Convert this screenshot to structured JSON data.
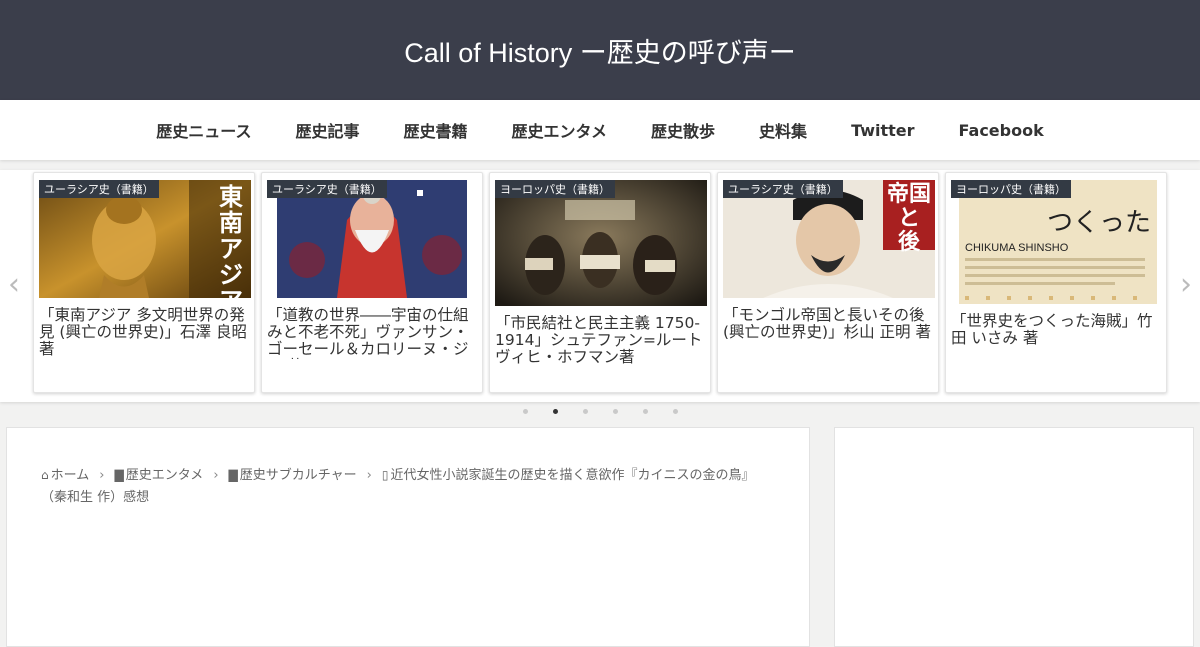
{
  "site": {
    "title": "Call of History ー歴史の呼び声ー"
  },
  "nav": {
    "items": [
      "歴史ニュース",
      "歴史記事",
      "歴史書籍",
      "歴史エンタメ",
      "歴史散歩",
      "史料集",
      "Twitter",
      "Facebook"
    ]
  },
  "carousel": {
    "prev_icon": "chevron-left-icon",
    "next_icon": "chevron-right-icon",
    "cards": [
      {
        "category": "ユーラシア史（書籍）",
        "title": "「東南アジア 多文明世界の発見 (興亡の世界史)」石澤 良昭 著",
        "cover_text": "東南アジア 多文明世界"
      },
      {
        "category": "ユーラシア史（書籍）",
        "title": "「道教の世界――宇宙の仕組みと不老不死」ヴァンサン・ゴーセール＆カロリーヌ・ジス 著"
      },
      {
        "category": "ヨーロッパ史（書籍）",
        "title": "「市民結社と民主主義 1750-1914」シュテファン=ルートヴィヒ・ホフマン著"
      },
      {
        "category": "ユーラシア史（書籍）",
        "title": "「モンゴル帝国と長いその後(興亡の世界史)」杉山 正明 著",
        "cover_text": "帝国と 後"
      },
      {
        "category": "ヨーロッパ史（書籍）",
        "title": "「世界史をつくった海賊」竹田 いさみ 著",
        "cover_text": "つくった",
        "cover_publisher": "CHIKUMA SHINSHO"
      }
    ],
    "dots": {
      "count": 6,
      "active": 1
    }
  },
  "breadcrumb": {
    "items": [
      "ホーム",
      "歴史エンタメ",
      "歴史サブカルチャー",
      "近代女性小説家誕生の歴史を描く意欲作『カイニスの金の鳥』（秦和生 作）感想"
    ]
  },
  "colors": {
    "header_bg": "#3b3e4b",
    "label_bg": "#333a44",
    "page_bg": "#f2f2f1"
  }
}
